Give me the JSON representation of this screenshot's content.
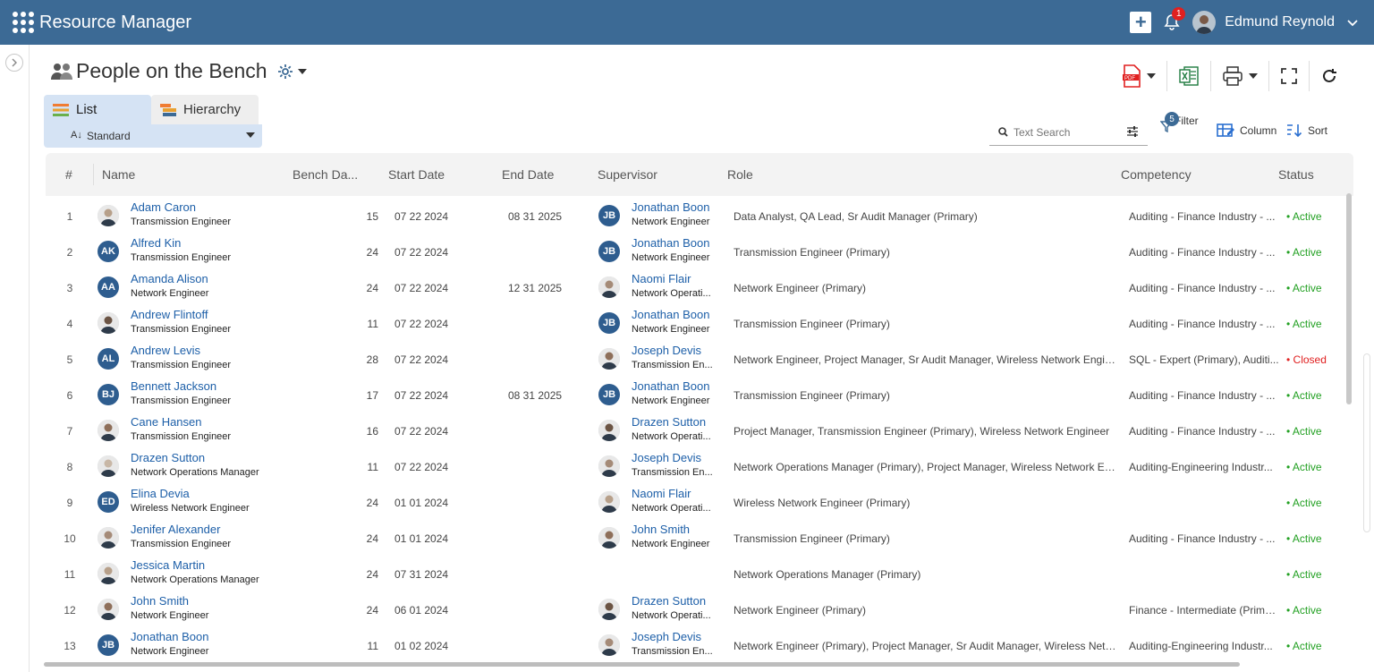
{
  "app": {
    "title": "Resource Manager"
  },
  "header": {
    "notification_count": "1",
    "user_name": "Edmund Reynold"
  },
  "page": {
    "title": "People on the Bench"
  },
  "tabs": [
    {
      "label": "List"
    },
    {
      "label": "Hierarchy"
    }
  ],
  "view": {
    "selected": "Standard"
  },
  "search": {
    "placeholder": "Text Search"
  },
  "filter": {
    "label": "Filter",
    "count": "5"
  },
  "column_btn": {
    "label": "Column"
  },
  "sort_btn": {
    "label": "Sort"
  },
  "columns": [
    "#",
    "Name",
    "Bench Da...",
    "Start Date",
    "End Date",
    "Supervisor",
    "Role",
    "Competency",
    "Status"
  ],
  "rows": [
    {
      "num": "1",
      "name": "Adam Caron",
      "title": "Transmission Engineer",
      "avatar": "photo",
      "initials": "",
      "bench": "15",
      "start": "07 22 2024",
      "end": "08 31 2025",
      "sup_name": "Jonathan Boon",
      "sup_title": "Network Engineer",
      "sup_avatar": "initials",
      "sup_initials": "JB",
      "role": "Data Analyst, QA Lead, Sr Audit Manager (Primary)",
      "competency": "Auditing - Finance Industry - ...",
      "status": "Active"
    },
    {
      "num": "2",
      "name": "Alfred Kin",
      "title": "Transmission Engineer",
      "avatar": "initials",
      "initials": "AK",
      "bench": "24",
      "start": "07 22 2024",
      "end": "",
      "sup_name": "Jonathan Boon",
      "sup_title": "Network Engineer",
      "sup_avatar": "initials",
      "sup_initials": "JB",
      "role": "Transmission Engineer (Primary)",
      "competency": "Auditing - Finance Industry - ...",
      "status": "Active"
    },
    {
      "num": "3",
      "name": "Amanda Alison",
      "title": "Network Engineer",
      "avatar": "initials",
      "initials": "AA",
      "bench": "24",
      "start": "07 22 2024",
      "end": "12 31 2025",
      "sup_name": "Naomi Flair",
      "sup_title": "Network Operati...",
      "sup_avatar": "photo",
      "sup_initials": "",
      "role": "Network Engineer (Primary)",
      "competency": "Auditing - Finance Industry - ...",
      "status": "Active"
    },
    {
      "num": "4",
      "name": "Andrew Flintoff",
      "title": "Transmission Engineer",
      "avatar": "photo",
      "initials": "",
      "bench": "11",
      "start": "07 22 2024",
      "end": "",
      "sup_name": "Jonathan Boon",
      "sup_title": "Network Engineer",
      "sup_avatar": "initials",
      "sup_initials": "JB",
      "role": "Transmission Engineer (Primary)",
      "competency": "Auditing - Finance Industry - ...",
      "status": "Active"
    },
    {
      "num": "5",
      "name": "Andrew Levis",
      "title": "Transmission Engineer",
      "avatar": "initials",
      "initials": "AL",
      "bench": "28",
      "start": "07 22 2024",
      "end": "",
      "sup_name": "Joseph Devis",
      "sup_title": "Transmission En...",
      "sup_avatar": "photo",
      "sup_initials": "",
      "role": "Network Engineer, Project Manager, Sr Audit Manager, Wireless Network Engin...",
      "competency": "SQL - Expert (Primary), Auditi...",
      "status": "Closed"
    },
    {
      "num": "6",
      "name": "Bennett Jackson",
      "title": "Transmission Engineer",
      "avatar": "initials",
      "initials": "BJ",
      "bench": "17",
      "start": "07 22 2024",
      "end": "08 31 2025",
      "sup_name": "Jonathan Boon",
      "sup_title": "Network Engineer",
      "sup_avatar": "initials",
      "sup_initials": "JB",
      "role": "Transmission Engineer (Primary)",
      "competency": "Auditing - Finance Industry - ...",
      "status": "Active"
    },
    {
      "num": "7",
      "name": "Cane Hansen",
      "title": "Transmission Engineer",
      "avatar": "photo",
      "initials": "",
      "bench": "16",
      "start": "07 22 2024",
      "end": "",
      "sup_name": "Drazen Sutton",
      "sup_title": "Network Operati...",
      "sup_avatar": "photo",
      "sup_initials": "",
      "role": "Project Manager, Transmission Engineer (Primary), Wireless Network Engineer",
      "competency": "Auditing - Finance Industry - ...",
      "status": "Active"
    },
    {
      "num": "8",
      "name": "Drazen Sutton",
      "title": "Network Operations Manager",
      "avatar": "photo",
      "initials": "",
      "bench": "11",
      "start": "07 22 2024",
      "end": "",
      "sup_name": "Joseph Devis",
      "sup_title": "Transmission En...",
      "sup_avatar": "photo",
      "sup_initials": "",
      "role": "Network Operations Manager (Primary), Project Manager, Wireless Network Eng...",
      "competency": "Auditing-Engineering Industr...",
      "status": "Active"
    },
    {
      "num": "9",
      "name": "Elina Devia",
      "title": "Wireless Network Engineer",
      "avatar": "initials",
      "initials": "ED",
      "bench": "24",
      "start": "01 01 2024",
      "end": "",
      "sup_name": "Naomi Flair",
      "sup_title": "Network Operati...",
      "sup_avatar": "photo",
      "sup_initials": "",
      "role": "Wireless Network Engineer (Primary)",
      "competency": "",
      "status": "Active"
    },
    {
      "num": "10",
      "name": "Jenifer Alexander",
      "title": "Transmission Engineer",
      "avatar": "photo",
      "initials": "",
      "bench": "24",
      "start": "01 01 2024",
      "end": "",
      "sup_name": "John Smith",
      "sup_title": "Network Engineer",
      "sup_avatar": "photo",
      "sup_initials": "",
      "role": "Transmission Engineer (Primary)",
      "competency": "Auditing - Finance Industry - ...",
      "status": "Active"
    },
    {
      "num": "11",
      "name": "Jessica Martin",
      "title": "Network Operations Manager",
      "avatar": "photo",
      "initials": "",
      "bench": "24",
      "start": "07 31 2024",
      "end": "",
      "sup_name": "",
      "sup_title": "",
      "sup_avatar": "",
      "sup_initials": "",
      "role": "Network Operations Manager (Primary)",
      "competency": "",
      "status": "Active"
    },
    {
      "num": "12",
      "name": "John Smith",
      "title": "Network Engineer",
      "avatar": "photo",
      "initials": "",
      "bench": "24",
      "start": "06 01 2024",
      "end": "",
      "sup_name": "Drazen Sutton",
      "sup_title": "Network Operati...",
      "sup_avatar": "photo",
      "sup_initials": "",
      "role": "Network Engineer (Primary)",
      "competency": "Finance - Intermediate (Prima...",
      "status": "Active"
    },
    {
      "num": "13",
      "name": "Jonathan Boon",
      "title": "Network Engineer",
      "avatar": "initials",
      "initials": "JB",
      "bench": "11",
      "start": "01 02 2024",
      "end": "",
      "sup_name": "Joseph Devis",
      "sup_title": "Transmission En...",
      "sup_avatar": "photo",
      "sup_initials": "",
      "role": "Network Engineer (Primary), Project Manager, Sr Audit Manager, Wireless Netw...",
      "competency": "Auditing-Engineering Industr...",
      "status": "Active"
    }
  ],
  "colors": {
    "topbar": "#3c6a95",
    "link": "#1d5fa8",
    "active": "#22a022",
    "closed": "#e02020"
  }
}
